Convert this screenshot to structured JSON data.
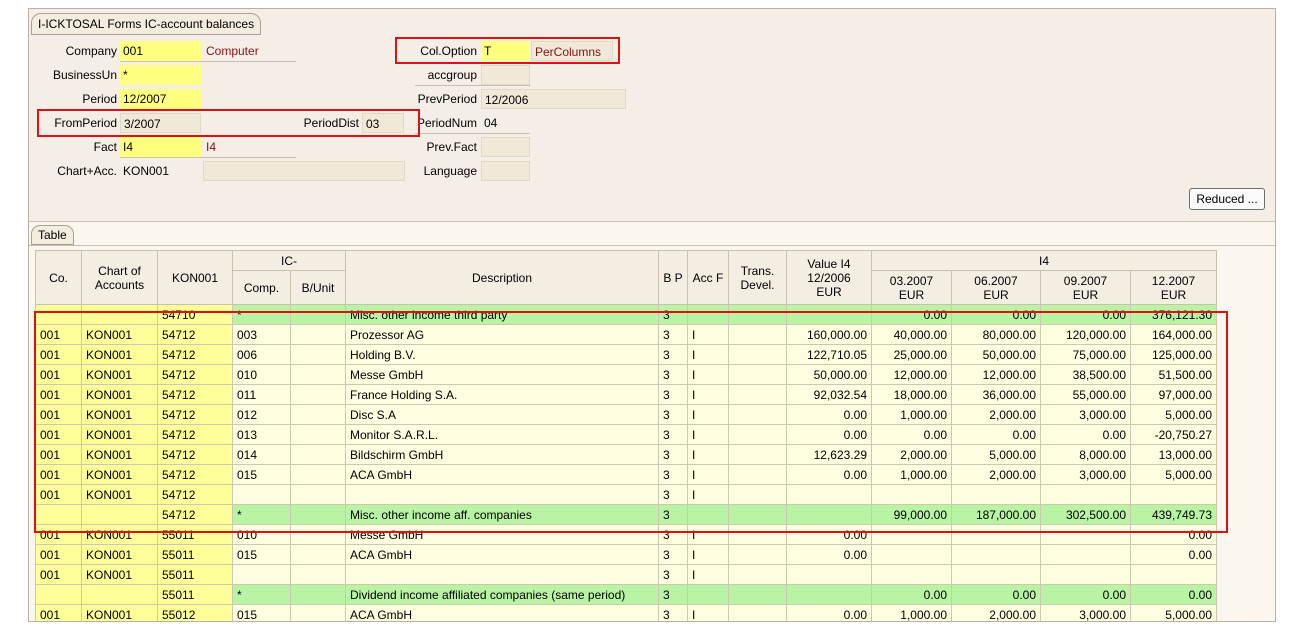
{
  "window_title": "I-ICKTOSAL Forms IC-account balances",
  "form": {
    "company": {
      "label": "Company",
      "value": "001",
      "desc": "Computer"
    },
    "business_unit": {
      "label": "BusinessUn",
      "value": "*"
    },
    "period": {
      "label": "Period",
      "value": "12/2007"
    },
    "from_period": {
      "label": "FromPeriod",
      "value": "3/2007"
    },
    "period_dist": {
      "label": "PeriodDist",
      "value": "03"
    },
    "fact": {
      "label": "Fact",
      "value": "I4",
      "desc": "I4"
    },
    "chart_acc": {
      "label": "Chart+Acc.",
      "value": "KON001"
    },
    "col_option": {
      "label": "Col.Option",
      "value": "T",
      "desc": "PerColumns"
    },
    "accgroup": {
      "label": "accgroup",
      "value": ""
    },
    "prev_period": {
      "label": "PrevPeriod",
      "value": "12/2006"
    },
    "period_num": {
      "label": "PeriodNum",
      "value": "04"
    },
    "prev_fact": {
      "label": "Prev.Fact",
      "value": ""
    },
    "language": {
      "label": "Language",
      "value": ""
    },
    "reduced_button": "Reduced ..."
  },
  "table_tab": "Table",
  "table": {
    "headers": {
      "co": "Co.",
      "chart": "Chart of Accounts",
      "kon": "KON001",
      "ic_group": "IC-",
      "comp": "Comp.",
      "bunit": "B/Unit",
      "desc": "Description",
      "bp": "B P",
      "acc": "Acc F",
      "trans": "Trans. Devel.",
      "value_line1": "Value I4",
      "value_line2": "12/2006",
      "value_line3": "EUR",
      "i4_group": "I4",
      "periods": [
        {
          "date": "03.2007",
          "cur": "EUR"
        },
        {
          "date": "06.2007",
          "cur": "EUR"
        },
        {
          "date": "09.2007",
          "cur": "EUR"
        },
        {
          "date": "12.2007",
          "cur": "EUR"
        }
      ]
    },
    "rows": [
      {
        "sum": true,
        "co": "",
        "chart": "",
        "acct": "54710",
        "comp": "*",
        "bunit": "",
        "desc": "Misc. other income third party",
        "bp": "3",
        "accf": "",
        "trans": "",
        "value": "",
        "p1": "0.00",
        "p2": "0.00",
        "p3": "0.00",
        "p4": "376,121.30"
      },
      {
        "sum": false,
        "co": "001",
        "chart": "KON001",
        "acct": "54712",
        "comp": "003",
        "bunit": "",
        "desc": "Prozessor AG",
        "bp": "3",
        "accf": "I",
        "trans": "",
        "value": "160,000.00",
        "p1": "40,000.00",
        "p2": "80,000.00",
        "p3": "120,000.00",
        "p4": "164,000.00"
      },
      {
        "sum": false,
        "co": "001",
        "chart": "KON001",
        "acct": "54712",
        "comp": "006",
        "bunit": "",
        "desc": "Holding B.V.",
        "bp": "3",
        "accf": "I",
        "trans": "",
        "value": "122,710.05",
        "p1": "25,000.00",
        "p2": "50,000.00",
        "p3": "75,000.00",
        "p4": "125,000.00"
      },
      {
        "sum": false,
        "co": "001",
        "chart": "KON001",
        "acct": "54712",
        "comp": "010",
        "bunit": "",
        "desc": "Messe GmbH",
        "bp": "3",
        "accf": "I",
        "trans": "",
        "value": "50,000.00",
        "p1": "12,000.00",
        "p2": "12,000.00",
        "p3": "38,500.00",
        "p4": "51,500.00"
      },
      {
        "sum": false,
        "co": "001",
        "chart": "KON001",
        "acct": "54712",
        "comp": "011",
        "bunit": "",
        "desc": "France Holding S.A.",
        "bp": "3",
        "accf": "I",
        "trans": "",
        "value": "92,032.54",
        "p1": "18,000.00",
        "p2": "36,000.00",
        "p3": "55,000.00",
        "p4": "97,000.00"
      },
      {
        "sum": false,
        "co": "001",
        "chart": "KON001",
        "acct": "54712",
        "comp": "012",
        "bunit": "",
        "desc": "Disc S.A",
        "bp": "3",
        "accf": "I",
        "trans": "",
        "value": "0.00",
        "p1": "1,000.00",
        "p2": "2,000.00",
        "p3": "3,000.00",
        "p4": "5,000.00"
      },
      {
        "sum": false,
        "co": "001",
        "chart": "KON001",
        "acct": "54712",
        "comp": "013",
        "bunit": "",
        "desc": "Monitor S.A.R.L.",
        "bp": "3",
        "accf": "I",
        "trans": "",
        "value": "0.00",
        "p1": "0.00",
        "p2": "0.00",
        "p3": "0.00",
        "p4": "-20,750.27"
      },
      {
        "sum": false,
        "co": "001",
        "chart": "KON001",
        "acct": "54712",
        "comp": "014",
        "bunit": "",
        "desc": "Bildschirm GmbH",
        "bp": "3",
        "accf": "I",
        "trans": "",
        "value": "12,623.29",
        "p1": "2,000.00",
        "p2": "5,000.00",
        "p3": "8,000.00",
        "p4": "13,000.00"
      },
      {
        "sum": false,
        "co": "001",
        "chart": "KON001",
        "acct": "54712",
        "comp": "015",
        "bunit": "",
        "desc": "ACA GmbH",
        "bp": "3",
        "accf": "I",
        "trans": "",
        "value": "0.00",
        "p1": "1,000.00",
        "p2": "2,000.00",
        "p3": "3,000.00",
        "p4": "5,000.00"
      },
      {
        "sum": false,
        "co": "001",
        "chart": "KON001",
        "acct": "54712",
        "comp": "",
        "bunit": "",
        "desc": "",
        "bp": "3",
        "accf": "I",
        "trans": "",
        "value": "",
        "p1": "",
        "p2": "",
        "p3": "",
        "p4": ""
      },
      {
        "sum": true,
        "co": "",
        "chart": "",
        "acct": "54712",
        "comp": "*",
        "bunit": "",
        "desc": "Misc. other income aff. companies",
        "bp": "3",
        "accf": "",
        "trans": "",
        "value": "",
        "p1": "99,000.00",
        "p2": "187,000.00",
        "p3": "302,500.00",
        "p4": "439,749.73"
      },
      {
        "sum": false,
        "co": "001",
        "chart": "KON001",
        "acct": "55011",
        "comp": "010",
        "bunit": "",
        "desc": "Messe GmbH",
        "bp": "3",
        "accf": "I",
        "trans": "",
        "value": "0.00",
        "p1": "",
        "p2": "",
        "p3": "",
        "p4": "0.00"
      },
      {
        "sum": false,
        "co": "001",
        "chart": "KON001",
        "acct": "55011",
        "comp": "015",
        "bunit": "",
        "desc": "ACA GmbH",
        "bp": "3",
        "accf": "I",
        "trans": "",
        "value": "0.00",
        "p1": "",
        "p2": "",
        "p3": "",
        "p4": "0.00"
      },
      {
        "sum": false,
        "co": "001",
        "chart": "KON001",
        "acct": "55011",
        "comp": "",
        "bunit": "",
        "desc": "",
        "bp": "3",
        "accf": "I",
        "trans": "",
        "value": "",
        "p1": "",
        "p2": "",
        "p3": "",
        "p4": ""
      },
      {
        "sum": true,
        "co": "",
        "chart": "",
        "acct": "55011",
        "comp": "*",
        "bunit": "",
        "desc": "Dividend income affiliated companies (same period)",
        "bp": "3",
        "accf": "",
        "trans": "",
        "value": "",
        "p1": "0.00",
        "p2": "0.00",
        "p3": "0.00",
        "p4": "0.00"
      },
      {
        "sum": false,
        "co": "001",
        "chart": "KON001",
        "acct": "55012",
        "comp": "015",
        "bunit": "",
        "desc": "ACA GmbH",
        "bp": "3",
        "accf": "I",
        "trans": "",
        "value": "0.00",
        "p1": "1,000.00",
        "p2": "2,000.00",
        "p3": "3,000.00",
        "p4": "5,000.00"
      }
    ]
  },
  "colors": {
    "highlight_border": "#e01010",
    "sum_row": "#b9f3a4",
    "input_yellow": "#ffff80",
    "desc_text": "#8a1010"
  }
}
